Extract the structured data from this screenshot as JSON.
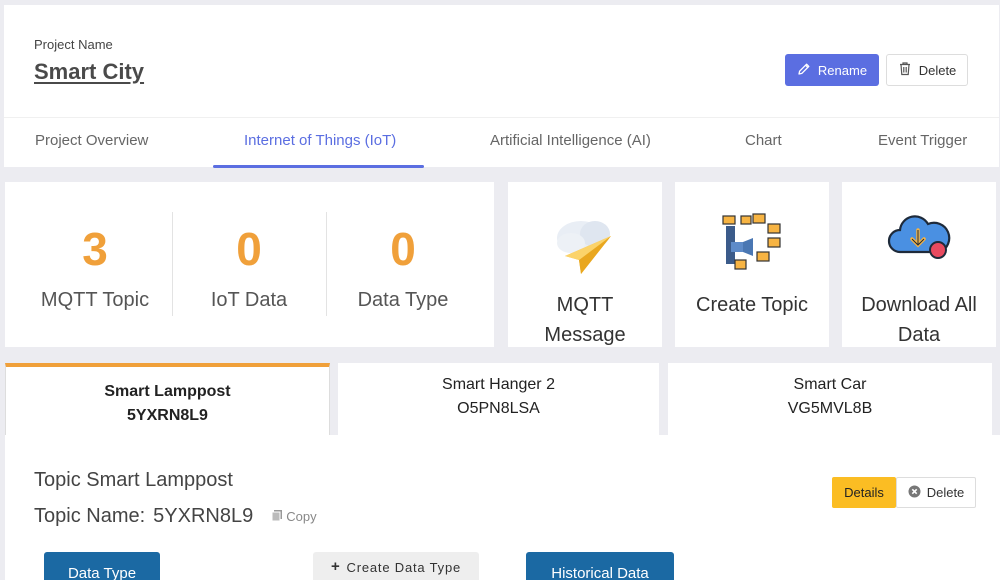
{
  "project": {
    "label": "Project Name",
    "name": "Smart City",
    "rename_label": "Rename",
    "delete_label": "Delete"
  },
  "tabs": [
    {
      "label": "Project Overview",
      "active": false
    },
    {
      "label": "Internet of Things (IoT)",
      "active": true
    },
    {
      "label": "Artificial Intelligence (AI)",
      "active": false
    },
    {
      "label": "Chart",
      "active": false
    },
    {
      "label": "Event Trigger",
      "active": false
    }
  ],
  "stats": [
    {
      "value": "3",
      "label": "MQTT Topic"
    },
    {
      "value": "0",
      "label": "IoT Data"
    },
    {
      "value": "0",
      "label": "Data Type"
    }
  ],
  "actions": [
    {
      "label_line1": "MQTT",
      "label_line2": "Message",
      "icon": "paper-plane-cloud-icon"
    },
    {
      "label_line1": "Create Topic",
      "label_line2": "",
      "icon": "topic-network-icon"
    },
    {
      "label_line1": "Download All",
      "label_line2": "Data",
      "icon": "cloud-download-icon"
    }
  ],
  "devices": [
    {
      "name": "Smart Lamppost",
      "code": "5YXRN8L9",
      "active": true
    },
    {
      "name": "Smart Hanger 2",
      "code": "O5PN8LSA",
      "active": false
    },
    {
      "name": "Smart Car",
      "code": "VG5MVL8B",
      "active": false
    }
  ],
  "topic": {
    "title": "Topic Smart Lamppost",
    "name_label": "Topic Name:",
    "name_value": "5YXRN8L9",
    "copy_label": "Copy",
    "details_label": "Details",
    "delete_label": "Delete"
  },
  "bottom_buttons": {
    "data_type": "Data Type",
    "create_data_type": "Create Data Type",
    "historical_data": "Historical Data"
  },
  "colors": {
    "accent": "#5b6ee1",
    "stat": "#f0a03a",
    "details": "#fbbd23",
    "primary_blue": "#1b69a3"
  }
}
